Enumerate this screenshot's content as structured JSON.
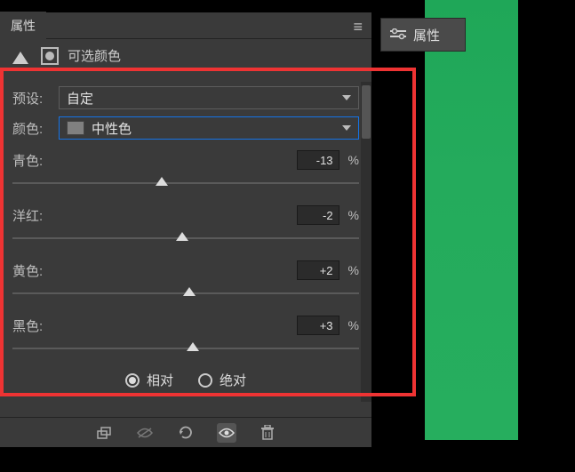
{
  "panel": {
    "tab": "属性",
    "floating_tab": "属性",
    "adjustment_title": "可选颜色"
  },
  "preset": {
    "label": "预设:",
    "value": "自定"
  },
  "colors": {
    "label": "颜色:",
    "value": "中性色",
    "swatch": "#808080"
  },
  "sliders": [
    {
      "label": "青色:",
      "value": "-13",
      "unit": "%",
      "pos": 43
    },
    {
      "label": "洋红:",
      "value": "-2",
      "unit": "%",
      "pos": 49
    },
    {
      "label": "黄色:",
      "value": "+2",
      "unit": "%",
      "pos": 51
    },
    {
      "label": "黑色:",
      "value": "+3",
      "unit": "%",
      "pos": 52
    }
  ],
  "mode": {
    "relative": "相对",
    "absolute": "绝对",
    "selected": "relative"
  },
  "accent": "#e33333"
}
